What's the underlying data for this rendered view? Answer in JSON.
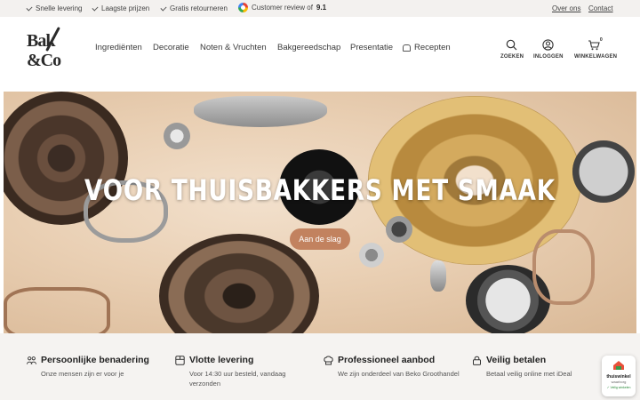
{
  "topbar": {
    "usps": [
      "Snelle levering",
      "Laagste prijzen",
      "Gratis retourneren"
    ],
    "review_label": "Customer review of",
    "review_score": "9.1",
    "links": [
      "Over ons",
      "Contact"
    ]
  },
  "header": {
    "logo_line1": "Bak",
    "logo_line2": "&Co",
    "nav": [
      "Ingrediënten",
      "Decoratie",
      "Noten & Vruchten",
      "Bakgereedschap",
      "Presentatie",
      "Recepten"
    ],
    "actions": {
      "search": "ZOEKEN",
      "login": "INLOGGEN",
      "cart": "WINKELWAGEN",
      "cart_count": "0"
    }
  },
  "hero": {
    "title": "VOOR THUISBAKKERS MET SMAAK",
    "button": "Aan de slag"
  },
  "features": [
    {
      "title": "Persoonlijke benadering",
      "text": "Onze mensen zijn er voor je",
      "icon": "people-icon"
    },
    {
      "title": "Vlotte levering",
      "text": "Voor 14:30 uur besteld, vandaag verzonden",
      "icon": "box-icon"
    },
    {
      "title": "Professioneel aanbod",
      "text": "We zijn onderdeel van Beko Groothandel",
      "icon": "chef-hat-icon"
    },
    {
      "title": "Veilig betalen",
      "text": "Betaal veilig online met iDeal",
      "icon": "lock-icon"
    }
  ],
  "badge": {
    "line1": "thuiswinkel",
    "line2": "waarborg",
    "line3": "✓ Veilig winkelen"
  },
  "colors": {
    "accent": "#c2825f",
    "topbar_bg": "#f3f1ef",
    "features_bg": "#f5f3f1"
  }
}
